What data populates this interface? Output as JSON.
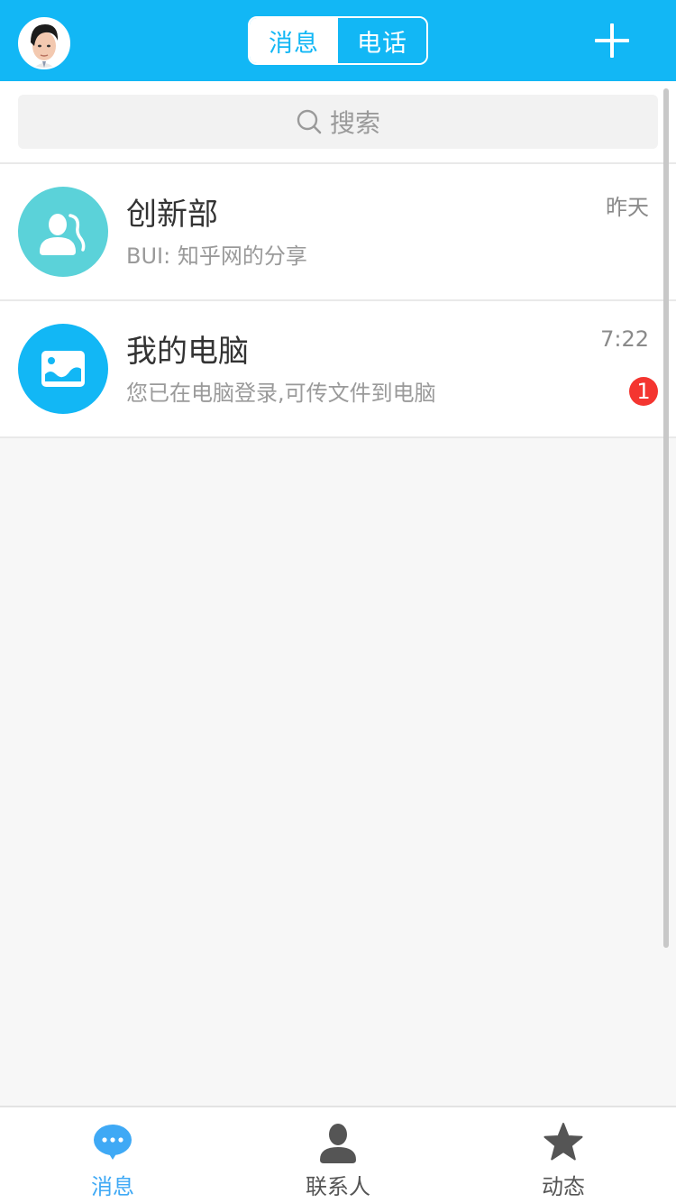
{
  "header": {
    "segment": [
      {
        "label": "消息",
        "active": true
      },
      {
        "label": "电话",
        "active": false
      }
    ],
    "add_icon": "plus-icon",
    "avatar_icon": "user-avatar"
  },
  "search": {
    "placeholder": "搜索",
    "icon": "search-icon"
  },
  "conversations": [
    {
      "title": "创新部",
      "subtitle": "BUI: 知乎网的分享",
      "time": "昨天",
      "icon": "group-icon",
      "avatar_color": "#5bd2d9"
    },
    {
      "title": "我的电脑",
      "subtitle": "您已在电脑登录,可传文件到电脑",
      "time": "7:22",
      "badge": "1",
      "icon": "image-icon",
      "avatar_color": "#12b7f5"
    }
  ],
  "tabbar": {
    "items": [
      {
        "label": "消息",
        "icon": "chat-bubble-icon",
        "active": true
      },
      {
        "label": "联系人",
        "icon": "person-icon",
        "active": false
      },
      {
        "label": "动态",
        "icon": "star-icon",
        "active": false
      }
    ]
  },
  "colors": {
    "primary": "#12b7f5",
    "tab_active": "#3fa9f5",
    "badge": "#f43530"
  }
}
